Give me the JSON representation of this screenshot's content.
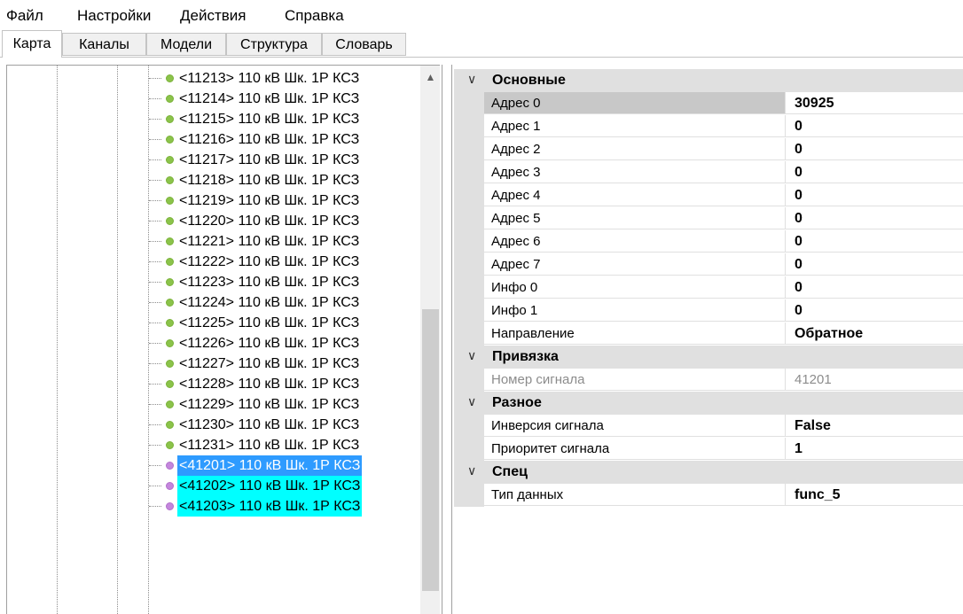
{
  "menu": [
    "Файл",
    "Настройки",
    "Действия",
    "Справка"
  ],
  "tabs": [
    "Карта",
    "Каналы",
    "Модели",
    "Структура",
    "Словарь"
  ],
  "tree": {
    "items": [
      {
        "text": "<11213> 110 кВ Шк. 1Р КСЗ",
        "color": "green",
        "state": "normal"
      },
      {
        "text": "<11214> 110 кВ Шк. 1Р КСЗ",
        "color": "green",
        "state": "normal"
      },
      {
        "text": "<11215> 110 кВ Шк. 1Р КСЗ",
        "color": "green",
        "state": "normal"
      },
      {
        "text": "<11216> 110 кВ Шк. 1Р КСЗ",
        "color": "green",
        "state": "normal"
      },
      {
        "text": "<11217> 110 кВ Шк. 1Р КСЗ",
        "color": "green",
        "state": "normal"
      },
      {
        "text": "<11218> 110 кВ Шк. 1Р КСЗ",
        "color": "green",
        "state": "normal"
      },
      {
        "text": "<11219> 110 кВ Шк. 1Р КСЗ",
        "color": "green",
        "state": "normal"
      },
      {
        "text": "<11220> 110 кВ Шк. 1Р КСЗ",
        "color": "green",
        "state": "normal"
      },
      {
        "text": "<11221> 110 кВ Шк. 1Р КСЗ",
        "color": "green",
        "state": "normal"
      },
      {
        "text": "<11222> 110 кВ Шк. 1Р КСЗ",
        "color": "green",
        "state": "normal"
      },
      {
        "text": "<11223> 110 кВ Шк. 1Р КСЗ",
        "color": "green",
        "state": "normal"
      },
      {
        "text": "<11224> 110 кВ Шк. 1Р КСЗ",
        "color": "green",
        "state": "normal"
      },
      {
        "text": "<11225> 110 кВ Шк. 1Р КСЗ",
        "color": "green",
        "state": "normal"
      },
      {
        "text": "<11226> 110 кВ Шк. 1Р КСЗ",
        "color": "green",
        "state": "normal"
      },
      {
        "text": "<11227> 110 кВ Шк. 1Р КСЗ",
        "color": "green",
        "state": "normal"
      },
      {
        "text": "<11228> 110 кВ Шк. 1Р КСЗ",
        "color": "green",
        "state": "normal"
      },
      {
        "text": "<11229> 110 кВ Шк. 1Р КСЗ",
        "color": "green",
        "state": "normal"
      },
      {
        "text": "<11230> 110 кВ Шк. 1Р КСЗ",
        "color": "green",
        "state": "normal"
      },
      {
        "text": "<11231> 110 кВ Шк. 1Р КСЗ",
        "color": "green",
        "state": "normal"
      },
      {
        "text": "<41201> 110 кВ Шк. 1Р КСЗ",
        "color": "purple",
        "state": "selected"
      },
      {
        "text": "<41202> 110 кВ Шк. 1Р КСЗ",
        "color": "purple",
        "state": "highlighted"
      },
      {
        "text": "<41203> 110 кВ Шк. 1Р КСЗ",
        "color": "purple",
        "state": "highlighted"
      }
    ],
    "scroll_up_icon": "chevron-up-icon"
  },
  "properties": {
    "categories": [
      {
        "name": "Основные",
        "props": [
          {
            "name": "Адрес 0",
            "value": "30925",
            "selected": true
          },
          {
            "name": "Адрес 1",
            "value": "0"
          },
          {
            "name": "Адрес 2",
            "value": "0"
          },
          {
            "name": "Адрес 3",
            "value": "0"
          },
          {
            "name": "Адрес 4",
            "value": "0"
          },
          {
            "name": "Адрес 5",
            "value": "0"
          },
          {
            "name": "Адрес 6",
            "value": "0"
          },
          {
            "name": "Адрес 7",
            "value": "0"
          },
          {
            "name": "Инфо 0",
            "value": "0"
          },
          {
            "name": "Инфо 1",
            "value": "0"
          },
          {
            "name": "Направление",
            "value": "Обратное"
          }
        ]
      },
      {
        "name": "Привязка",
        "props": [
          {
            "name": "Номер сигнала",
            "value": "41201",
            "disabled": true
          }
        ]
      },
      {
        "name": "Разное",
        "props": [
          {
            "name": "Инверсия сигнала",
            "value": "False"
          },
          {
            "name": "Приоритет сигнала",
            "value": "1"
          }
        ]
      },
      {
        "name": "Спец",
        "props": [
          {
            "name": "Тип данных",
            "value": "func_5"
          }
        ]
      }
    ]
  },
  "colors": {
    "selected_blue": "#2e9bff",
    "highlight_cyan": "#00ffff",
    "bullet_green": "#8bc34a",
    "bullet_purple": "#c487dc"
  }
}
